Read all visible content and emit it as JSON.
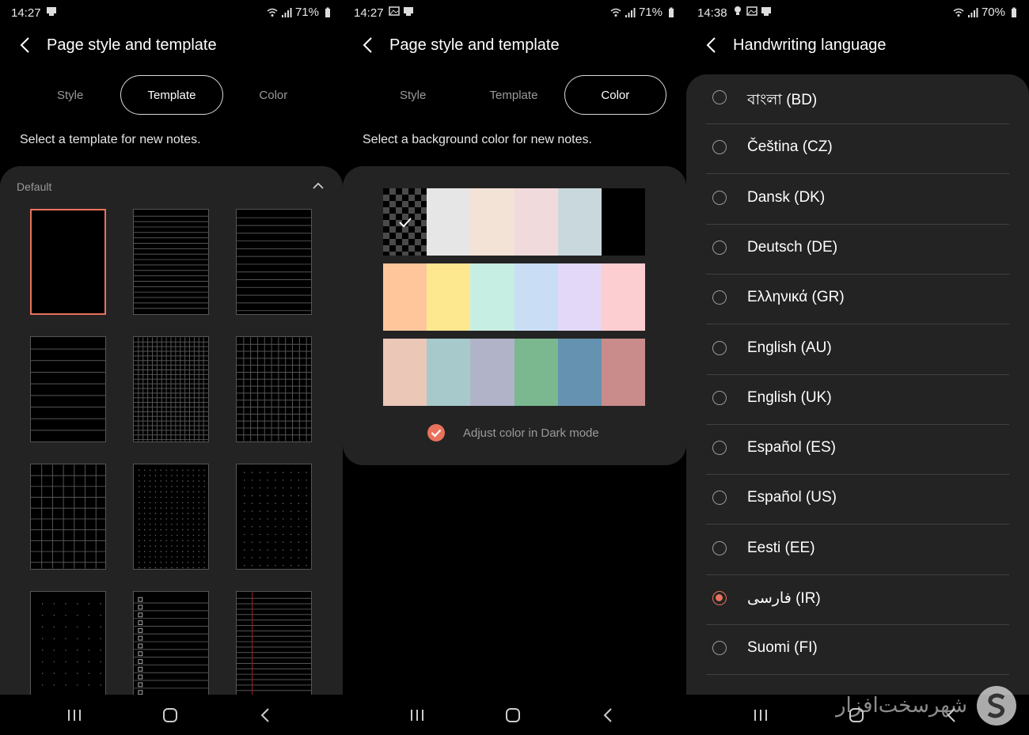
{
  "panel1": {
    "status": {
      "time": "14:27",
      "battery": "71%"
    },
    "title": "Page style and template",
    "tabs": [
      "Style",
      "Template",
      "Color"
    ],
    "active_tab": "Template",
    "description": "Select a template for new notes.",
    "section_label": "Default",
    "templates": [
      {
        "type": "blank",
        "selected": true
      },
      {
        "type": "narrow-lines"
      },
      {
        "type": "lines"
      },
      {
        "type": "wide-lines"
      },
      {
        "type": "small-grid"
      },
      {
        "type": "grid"
      },
      {
        "type": "large-grid"
      },
      {
        "type": "small-dots"
      },
      {
        "type": "dots"
      },
      {
        "type": "large-dots"
      },
      {
        "type": "checklist"
      },
      {
        "type": "margin-lines"
      }
    ]
  },
  "panel2": {
    "status": {
      "time": "14:27",
      "battery": "71%"
    },
    "title": "Page style and template",
    "tabs": [
      "Style",
      "Template",
      "Color"
    ],
    "active_tab": "Color",
    "description": "Select a background color for new notes.",
    "color_rows": [
      [
        "checker",
        "#e6e6e6",
        "#f3e2d6",
        "#f1dadc",
        "#c9d8dc",
        "#000000"
      ],
      [
        "#ffc69b",
        "#fde78f",
        "#c7eee2",
        "#c9def4",
        "#e3d8f7",
        "#fccdd1"
      ],
      [
        "#ebc7b8",
        "#a7c9cb",
        "#b1b3c9",
        "#7bb88f",
        "#6592b1",
        "#c98c8b"
      ]
    ],
    "selected_color": "checker",
    "adjust_label": "Adjust color in Dark mode",
    "adjust_checked": true,
    "accent": "#e8725c"
  },
  "panel3": {
    "status": {
      "time": "14:38",
      "battery": "70%"
    },
    "title": "Handwriting language",
    "languages": [
      {
        "label": "বাংলা (BD)"
      },
      {
        "label": "Čeština (CZ)"
      },
      {
        "label": "Dansk (DK)"
      },
      {
        "label": "Deutsch (DE)"
      },
      {
        "label": "Ελληνικά (GR)"
      },
      {
        "label": "English (AU)"
      },
      {
        "label": "English (UK)"
      },
      {
        "label": "Español (ES)"
      },
      {
        "label": "Español (US)"
      },
      {
        "label": "Eesti (EE)"
      },
      {
        "label": "فارسی (IR)",
        "selected": true
      },
      {
        "label": "Suomi (FI)"
      }
    ],
    "watermark": "شهرسخت‌افزار"
  }
}
